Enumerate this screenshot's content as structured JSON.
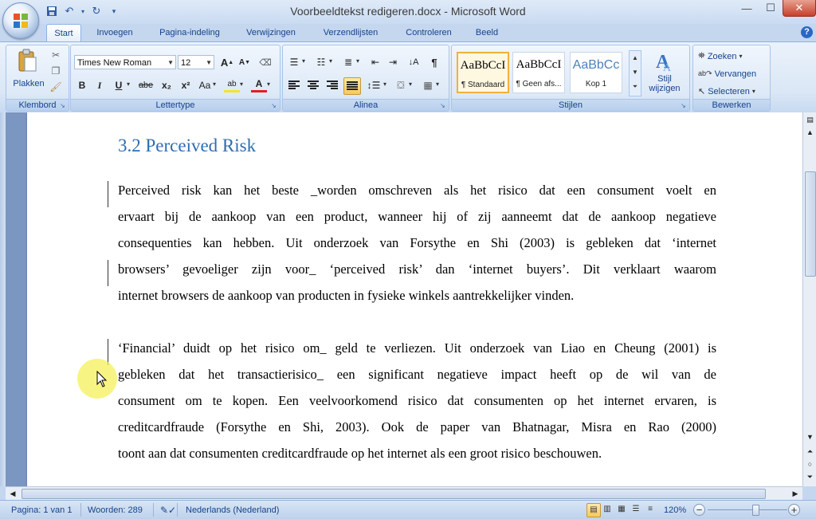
{
  "window": {
    "title": "Voorbeeldtekst redigeren.docx - Microsoft Word"
  },
  "qat": {
    "save_icon": "save-icon",
    "undo_icon": "undo-icon",
    "redo_icon": "redo-icon",
    "customize_icon": "customize-icon"
  },
  "tabs": [
    {
      "label": "Start",
      "active": true
    },
    {
      "label": "Invoegen"
    },
    {
      "label": "Pagina-indeling"
    },
    {
      "label": "Verwijzingen"
    },
    {
      "label": "Verzendlijsten"
    },
    {
      "label": "Controleren"
    },
    {
      "label": "Beeld"
    }
  ],
  "ribbon": {
    "clipboard": {
      "label": "Klembord",
      "paste": "Plakken"
    },
    "font": {
      "label": "Lettertype",
      "family": "Times New Roman",
      "size": "12",
      "bold": "B",
      "italic": "I",
      "underline": "U",
      "strike": "abe",
      "subscript": "x₂",
      "superscript": "x²",
      "case": "Aa",
      "grow": "A",
      "shrink": "A",
      "highlight": "ab",
      "color": "A"
    },
    "paragraph": {
      "label": "Alinea",
      "pilcrow": "¶"
    },
    "styles": {
      "label": "Stijlen",
      "tiles": [
        {
          "sample": "AaBbCcI",
          "name": "¶ Standaard",
          "active": true
        },
        {
          "sample": "AaBbCcI",
          "name": "¶ Geen afs..."
        },
        {
          "sample": "AaBbCc",
          "name": "Kop 1"
        }
      ],
      "change": "Stijl wijzigen"
    },
    "editing": {
      "label": "Bewerken",
      "find": "Zoeken",
      "replace": "Vervangen",
      "select": "Selecteren"
    }
  },
  "document": {
    "heading": "3.2 Perceived Risk",
    "para1": [
      "Perceived risk kan het beste _worden omschreven als het risico dat een consument voelt en",
      "ervaart bij de aankoop van een product, wanneer hij of zij aanneemt dat de aankoop negatieve",
      "consequenties kan hebben. Uit onderzoek van Forsythe en Shi (2003) is gebleken dat ‘internet",
      "browsers’ gevoeliger zijn voor_ ‘perceived risk’ dan ‘internet buyers’. Dit verklaart waarom",
      "internet browsers de aankoop van producten in fysieke winkels aantrekkelijker vinden."
    ],
    "para2": [
      "‘Financial’ duidt op het risico om_ geld te verliezen. Uit onderzoek van Liao en Cheung (2001) is",
      "gebleken dat het transactierisico_ een significant negatieve impact heeft op de wil van de",
      "consument om te kopen. Een veelvoorkomend risico dat consumenten op het internet ervaren, is",
      "creditcardfraude (Forsythe en Shi, 2003). Ook de paper van Bhatnagar, Misra en Rao (2000)",
      "toont aan dat consumenten creditcardfraude op het internet als een groot risico beschouwen."
    ]
  },
  "status": {
    "page": "Pagina: 1 van 1",
    "words": "Woorden: 289",
    "language": "Nederlands (Nederland)",
    "zoom": "120%",
    "zoom_level_pct": 60
  }
}
